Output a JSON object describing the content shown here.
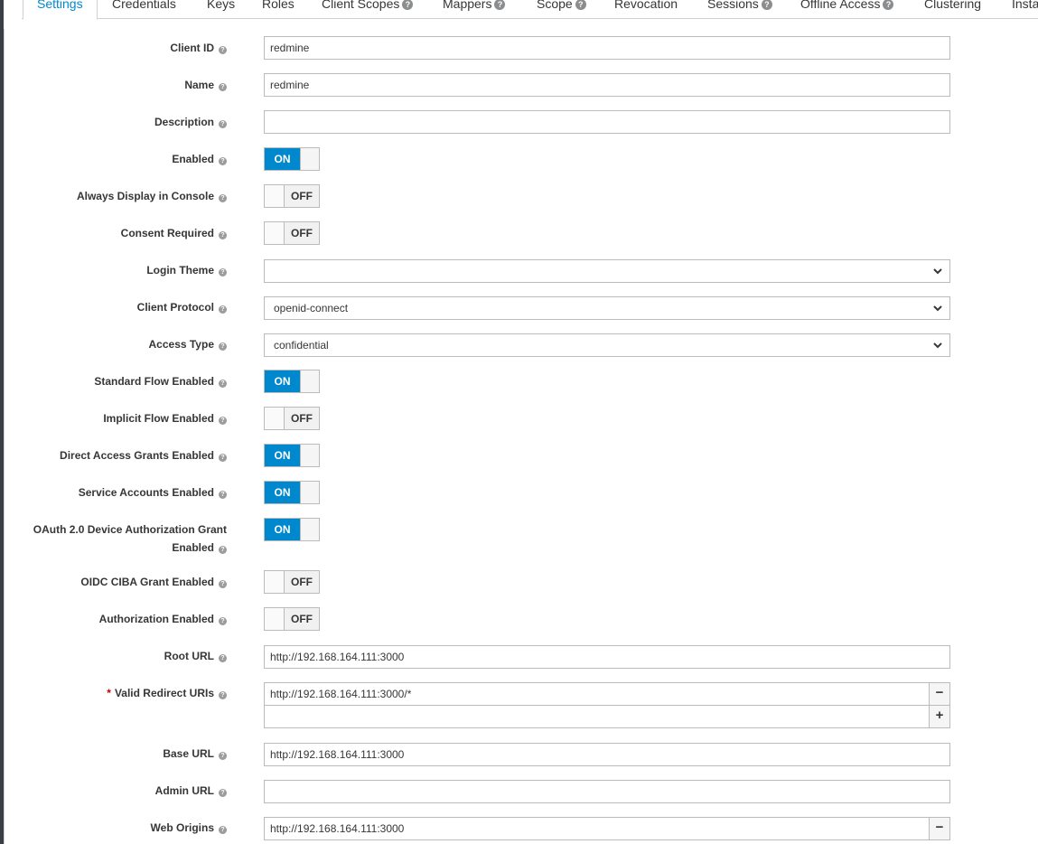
{
  "tabs": [
    {
      "label": "Settings",
      "active": true
    },
    {
      "label": "Credentials"
    },
    {
      "label": "Keys"
    },
    {
      "label": "Roles"
    },
    {
      "label": "Client Scopes",
      "help": true
    },
    {
      "label": "Mappers",
      "help": true
    },
    {
      "label": "Scope",
      "help": true
    },
    {
      "label": "Revocation"
    },
    {
      "label": "Sessions",
      "help": true
    },
    {
      "label": "Offline Access",
      "help": true
    },
    {
      "label": "Clustering"
    },
    {
      "label": "Installation"
    }
  ],
  "help_glyph": "?",
  "required_mark": "*",
  "form": {
    "client_id": {
      "label": "Client ID",
      "value": "redmine"
    },
    "name": {
      "label": "Name",
      "value": "redmine"
    },
    "description": {
      "label": "Description",
      "value": ""
    },
    "enabled": {
      "label": "Enabled",
      "state": "ON"
    },
    "always_display": {
      "label": "Always Display in Console",
      "state": "OFF"
    },
    "consent_required": {
      "label": "Consent Required",
      "state": "OFF"
    },
    "login_theme": {
      "label": "Login Theme",
      "value": ""
    },
    "client_protocol": {
      "label": "Client Protocol",
      "value": "openid-connect"
    },
    "access_type": {
      "label": "Access Type",
      "value": "confidential"
    },
    "standard_flow": {
      "label": "Standard Flow Enabled",
      "state": "ON"
    },
    "implicit_flow": {
      "label": "Implicit Flow Enabled",
      "state": "OFF"
    },
    "direct_access": {
      "label": "Direct Access Grants Enabled",
      "state": "ON"
    },
    "service_accounts": {
      "label": "Service Accounts Enabled",
      "state": "ON"
    },
    "device_grant": {
      "label_line1": "OAuth 2.0 Device Authorization Grant",
      "label_line2": "Enabled",
      "state": "ON"
    },
    "ciba": {
      "label": "OIDC CIBA Grant Enabled",
      "state": "OFF"
    },
    "authorization": {
      "label": "Authorization Enabled",
      "state": "OFF"
    },
    "root_url": {
      "label": "Root URL",
      "value": "http://192.168.164.111:3000"
    },
    "redirect_uris": {
      "label": "Valid Redirect URIs",
      "values": [
        "http://192.168.164.111:3000/*",
        ""
      ]
    },
    "base_url": {
      "label": "Base URL",
      "value": "http://192.168.164.111:3000"
    },
    "admin_url": {
      "label": "Admin URL",
      "value": ""
    },
    "web_origins": {
      "label": "Web Origins",
      "values": [
        "http://192.168.164.111:3000"
      ]
    }
  },
  "buttons": {
    "remove": "−",
    "add": "+"
  },
  "colors": {
    "accent": "#0088ce",
    "required": "#cc0000"
  }
}
